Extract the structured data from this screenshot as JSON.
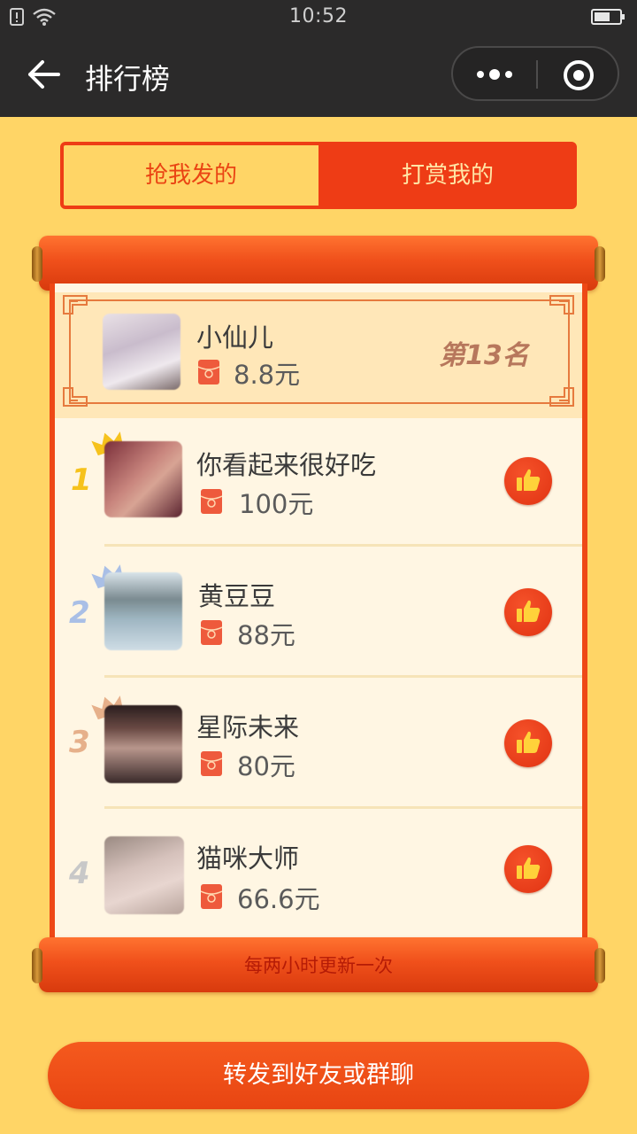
{
  "status_bar": {
    "time": "10:52"
  },
  "nav": {
    "title": "排行榜"
  },
  "tabs": [
    {
      "label": "抢我发的",
      "selected": false
    },
    {
      "label": "打赏我的",
      "selected": true
    }
  ],
  "my_rank": {
    "name": "小仙儿",
    "amount": "8.8元",
    "rank": "第13名"
  },
  "leaderboard": [
    {
      "rank": "1",
      "name": "你看起来很好吃",
      "amount": "100元",
      "crown": "gold"
    },
    {
      "rank": "2",
      "name": "黄豆豆",
      "amount": "88元",
      "crown": "silver"
    },
    {
      "rank": "3",
      "name": "星际未来",
      "amount": "80元",
      "crown": "bronze"
    },
    {
      "rank": "4",
      "name": "猫咪大师",
      "amount": "66.6元",
      "crown": "none"
    }
  ],
  "footer_note": "每两小时更新一次",
  "share_button": "转发到好友或群聊",
  "colors": {
    "background": "#ffd566",
    "accent_red": "#ee3c15",
    "rank_gold": "#f6c21c",
    "rank_silver": "#a9bfe6",
    "rank_bronze": "#e6b08a",
    "rank_other": "#c8c8c8"
  }
}
